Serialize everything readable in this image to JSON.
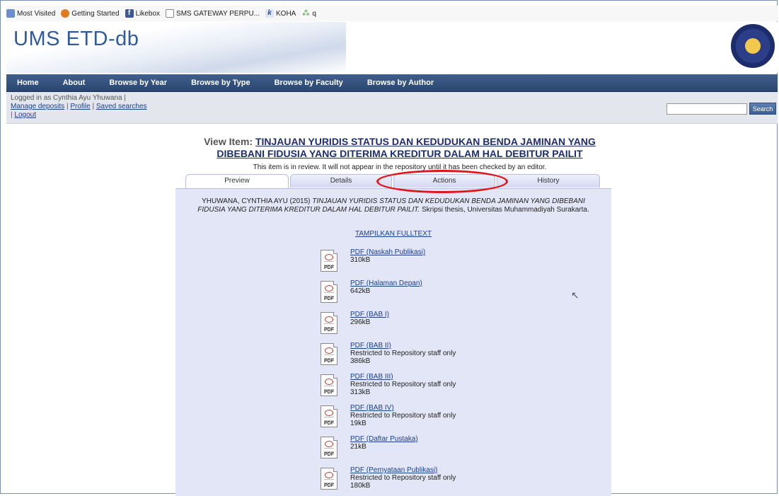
{
  "bookmarks": [
    {
      "label": "Most Visited",
      "icon": "most-visited-icon"
    },
    {
      "label": "Getting Started",
      "icon": "firefox-icon"
    },
    {
      "label": "Likebox",
      "icon": "facebook-icon"
    },
    {
      "label": "SMS GATEWAY PERPU...",
      "icon": "page-icon"
    },
    {
      "label": "KOHA",
      "icon": "koha-icon"
    },
    {
      "label": "q",
      "icon": "q-icon"
    }
  ],
  "header": {
    "site_title": "UMS ETD-db",
    "logo": "university-seal-icon"
  },
  "nav": [
    "Home",
    "About",
    "Browse by Year",
    "Browse by Type",
    "Browse by Faculty",
    "Browse by Author"
  ],
  "login": {
    "status": "Logged in as Cynthia Ayu Yhuwana |",
    "links": [
      "Manage deposits",
      "Profile",
      "Saved searches"
    ],
    "logout": "Logout",
    "search_button": "Search",
    "search_value": ""
  },
  "item": {
    "label": "View Item:",
    "title": "TINJAUAN YURIDIS STATUS DAN KEDUDUKAN BENDA JAMINAN YANG DIBEBANI FIDUSIA YANG DITERIMA KREDITUR DALAM HAL DEBITUR PAILIT",
    "review_note": "This item is in review. It will not appear in the repository until it has been checked by an editor.",
    "tabs": [
      "Preview",
      "Details",
      "Actions",
      "History"
    ],
    "active_tab": "Preview",
    "citation_author": "YHUWANA, CYNTHIA AYU (2015)",
    "citation_title": "TINJAUAN YURIDIS STATUS DAN KEDUDUKAN BENDA JAMINAN YANG DIBEBANI FIDUSIA YANG DITERIMA KREDITUR DALAM HAL DEBITUR PAILIT.",
    "citation_rest": "Skripsi thesis, Universitas Muhammadiyah Surakarta.",
    "fulltext_link": "TAMPILKAN FULLTEXT",
    "documents": [
      {
        "name": "PDF (Naskah Publikasi)",
        "note": "",
        "size": "310kB"
      },
      {
        "name": "PDF (Halaman Depan)",
        "note": "",
        "size": "642kB"
      },
      {
        "name": "PDF (BAB I)",
        "note": "",
        "size": "296kB"
      },
      {
        "name": "PDF (BAB II)",
        "note": "Restricted to Repository staff only",
        "size": "386kB"
      },
      {
        "name": "PDF (BAB III)",
        "note": "Restricted to Repository staff only",
        "size": "313kB"
      },
      {
        "name": "PDF (BAB IV)",
        "note": "Restricted to Repository staff only",
        "size": "19kB"
      },
      {
        "name": "PDF (Daftar Pustaka)",
        "note": "",
        "size": "21kB"
      },
      {
        "name": "PDF (Pernyataan Publikasi)",
        "note": "Restricted to Repository staff only",
        "size": "180kB"
      }
    ],
    "pdf_icon_label": "PDF"
  },
  "colors": {
    "nav_bg": "#2a4770",
    "title_blue": "#2f5b9e",
    "annotation_red": "#e0161d",
    "panel_bg": "#e3e6f7"
  }
}
